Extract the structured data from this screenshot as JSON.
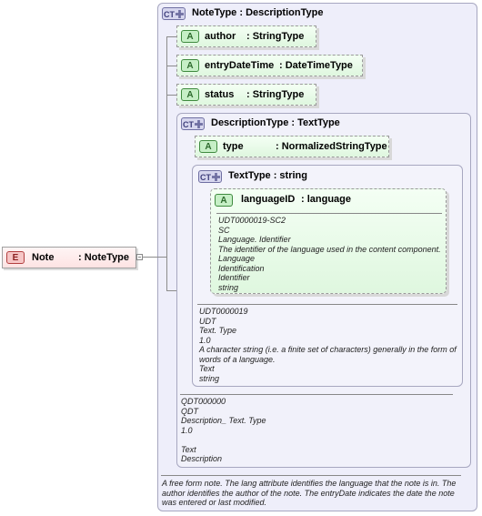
{
  "element": {
    "badge": "E",
    "name": "Note",
    "type": ": NoteType"
  },
  "note_type": {
    "badge": "CT",
    "title": "NoteType : DescriptionType",
    "attributes": [
      {
        "badge": "A",
        "name": "author",
        "type": ": StringType"
      },
      {
        "badge": "A",
        "name": "entryDateTime",
        "type": ": DateTimeType"
      },
      {
        "badge": "A",
        "name": "status",
        "type": ": StringType"
      }
    ],
    "documentation": [
      "A free form note. The lang attribute identifies the language that the note is in. The",
      "author identifies the author of the note. The entryDate indicates the date the note",
      "was entered or last modified."
    ]
  },
  "description_type": {
    "badge": "CT",
    "title": "DescriptionType : TextType",
    "attribute": {
      "badge": "A",
      "name": "type",
      "type": ": NormalizedStringType"
    },
    "documentation": [
      "QDT000000",
      "QDT",
      "Description_ Text. Type",
      "1.0",
      "",
      "Text",
      "Description"
    ]
  },
  "text_type": {
    "badge": "CT",
    "title": "TextType : string",
    "attribute": {
      "badge": "A",
      "name": "languageID",
      "type": ": language",
      "documentation": [
        "UDT0000019-SC2",
        "SC",
        "Language. Identifier",
        "The identifier of the language used in the content component.",
        "Language",
        "Identification",
        "Identifier",
        "string"
      ]
    },
    "documentation": [
      "UDT0000019",
      "UDT",
      "Text. Type",
      "1.0",
      "A character string (i.e. a finite set of characters) generally in the form of",
      "words of a language.",
      "Text",
      "string"
    ]
  }
}
